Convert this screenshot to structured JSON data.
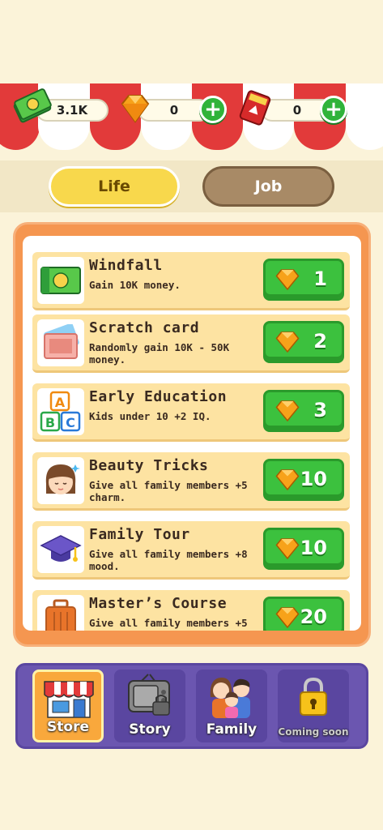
{
  "currencies": {
    "money": {
      "value": "3.1K",
      "icon": "cash-icon"
    },
    "gems": {
      "value": "0",
      "icon": "gem-icon"
    },
    "tickets": {
      "value": "0",
      "icon": "ticket-icon"
    }
  },
  "tabs": {
    "life": "Life",
    "job": "Job"
  },
  "store_items": [
    {
      "title": "Windfall",
      "desc": "Gain 10K money.",
      "price": "1",
      "icon": "cash-icon"
    },
    {
      "title": "Scratch card",
      "desc": "Randomly gain 10K - 50K money.",
      "price": "2",
      "icon": "scratch-card-icon"
    },
    {
      "title": "Early Education",
      "desc": "Kids under 10 +2 IQ.",
      "price": "3",
      "icon": "abc-blocks-icon"
    },
    {
      "title": "Beauty Tricks",
      "desc": "Give all family members +5 charm.",
      "price": "10",
      "icon": "woman-face-icon"
    },
    {
      "title": "Family Tour",
      "desc": "Give all family members +8 mood.",
      "price": "10",
      "icon": "graduation-cap-icon"
    },
    {
      "title": "Master’s Course",
      "desc": "Give all family members +5",
      "price": "20",
      "icon": "suitcase-icon"
    }
  ],
  "nav": {
    "store": "Store",
    "story": "Story",
    "family": "Family",
    "coming_soon": "Coming soon"
  },
  "colors": {
    "accent": "#f59650",
    "green": "#3cc13e",
    "purple": "#6b56b0",
    "red": "#e23a3a"
  }
}
